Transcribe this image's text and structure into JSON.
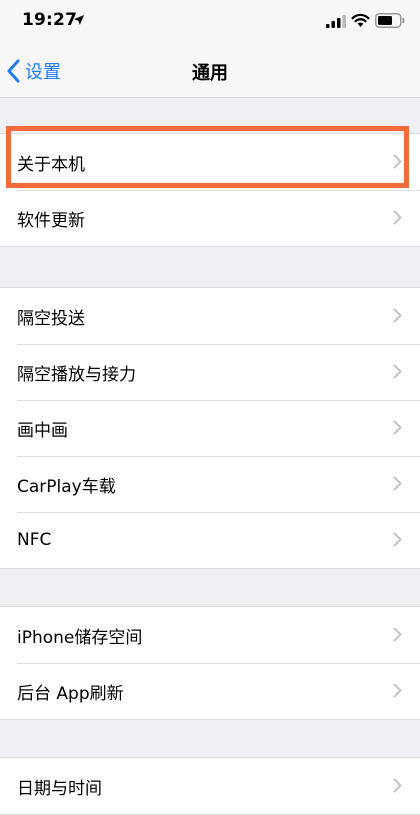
{
  "status": {
    "time": "19:27"
  },
  "nav": {
    "back_label": "设置",
    "title": "通用"
  },
  "groups": [
    {
      "rows": [
        {
          "label": "关于本机"
        },
        {
          "label": "软件更新"
        }
      ]
    },
    {
      "rows": [
        {
          "label": "隔空投送"
        },
        {
          "label": "隔空播放与接力"
        },
        {
          "label": "画中画"
        },
        {
          "label": "CarPlay车载"
        },
        {
          "label": "NFC"
        }
      ]
    },
    {
      "rows": [
        {
          "label": "iPhone储存空间"
        },
        {
          "label": "后台 App刷新"
        }
      ]
    },
    {
      "rows": [
        {
          "label": "日期与时间"
        }
      ]
    }
  ],
  "colors": {
    "accent": "#1f7cf5",
    "highlight": "#f26b3a",
    "background": "#efeff4"
  }
}
